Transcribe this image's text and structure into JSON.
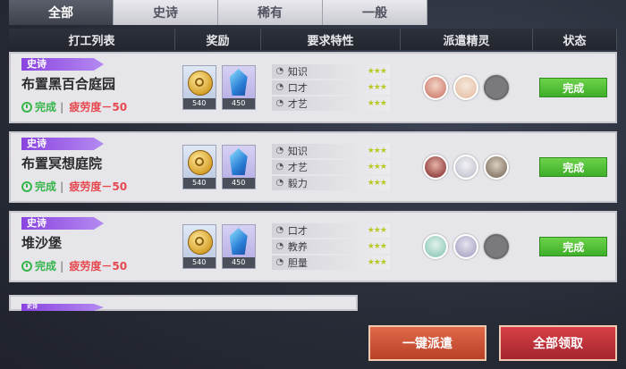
{
  "tabs": [
    {
      "label": "全部",
      "active": true
    },
    {
      "label": "史诗",
      "active": false
    },
    {
      "label": "稀有",
      "active": false
    },
    {
      "label": "一般",
      "active": false
    }
  ],
  "columns": {
    "job_list": "打工列表",
    "reward": "奖励",
    "traits": "要求特性",
    "sprites": "派遣精灵",
    "status": "状态"
  },
  "jobs": [
    {
      "rarity": "史诗",
      "title": "布置黑百合庭园",
      "status": "完成",
      "fatigue": "疲劳度－50",
      "rewards": [
        {
          "icon": "coin-icon",
          "value": "540"
        },
        {
          "icon": "crystal-icon",
          "value": "450"
        }
      ],
      "traits": [
        "知识",
        "口才",
        "才艺"
      ],
      "sprites": [
        {
          "color": "#d48a7c"
        },
        {
          "color": "#e8c6b0"
        },
        {
          "color": "empty"
        }
      ],
      "button": "完成"
    },
    {
      "rarity": "史诗",
      "title": "布置冥想庭院",
      "status": "完成",
      "fatigue": "疲劳度－50",
      "rewards": [
        {
          "icon": "coin-icon",
          "value": "540"
        },
        {
          "icon": "crystal-icon",
          "value": "450"
        }
      ],
      "traits": [
        "知识",
        "才艺",
        "毅力"
      ],
      "sprites": [
        {
          "color": "#9a4b4b"
        },
        {
          "color": "#c9c9d4"
        },
        {
          "color": "#8e8070"
        }
      ],
      "button": "完成"
    },
    {
      "rarity": "史诗",
      "title": "堆沙堡",
      "status": "完成",
      "fatigue": "疲劳度－50",
      "rewards": [
        {
          "icon": "coin-icon",
          "value": "540"
        },
        {
          "icon": "crystal-icon",
          "value": "450"
        }
      ],
      "traits": [
        "口才",
        "教养",
        "胆量"
      ],
      "sprites": [
        {
          "color": "#9ccfc0"
        },
        {
          "color": "#b3aecb"
        },
        {
          "color": "empty"
        }
      ],
      "button": "完成"
    }
  ],
  "partial_row_tag": "史诗",
  "buttons": {
    "dispatch_all": "一键派遣",
    "collect_all": "全部领取"
  },
  "colors": {
    "accent_green": "#3fae2a",
    "epic_purple": "#8a44e0",
    "fatigue_red": "#e5494f"
  }
}
